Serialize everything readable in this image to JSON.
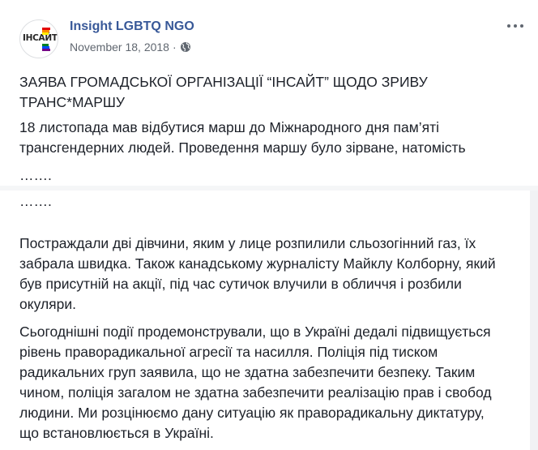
{
  "post": {
    "page_name": "Insight LGBTQ NGO",
    "date": "November 18, 2018",
    "separator": "·",
    "avatar_logo_text": "ІНСАЙТ",
    "icons": {
      "privacy": "globe-icon",
      "options": "more-options-icon"
    },
    "colors": {
      "page_name": "#385898",
      "meta": "#606770",
      "body_text": "#1d2129",
      "logo_stripes": [
        "#e40303",
        "#ff8c00",
        "#ffed00",
        "#008026",
        "#004dff",
        "#750787"
      ]
    },
    "title_lines": [
      "ЗАЯВА ГРОМАДСЬКОЇ ОРГАНІЗАЦІЇ “ІНСАЙТ” ЩОДО ЗРИВУ",
      "ТРАНС*МАРШУ"
    ],
    "paragraph1_lines": [
      "18 листопада мав відбутися марш до Міжнародного дня пам’яті",
      "трансгендерних людей. Проведення маршу було зірване, натомість"
    ],
    "ellipsis_1": "…….",
    "ellipsis_2": "…….",
    "paragraph2_lines": [
      "Постраждали дві дівчини, яким у лице розпилили сльозогінний газ, їх",
      "забрала швидка. Також канадському журналісту Майклу Колборну, який",
      "був присутній на акції, під час сутичок влучили в обличчя і розбили",
      "окуляри."
    ],
    "paragraph3_lines": [
      "Сьогоднішні події продемонстрували, що в Україні дедалі підвищується",
      "рівень праворадикальної агресії та насилля. Поліція під тиском",
      "радикальних груп заявила, що не здатна забезпечити безпеку. Таким",
      "чином, поліція загалом не здатна забезпечити реалізацію прав і свобод",
      "людини. Ми розцінюємо дану ситуацію як праворадикальну диктатуру,",
      "що встановлюється в Україні."
    ]
  }
}
